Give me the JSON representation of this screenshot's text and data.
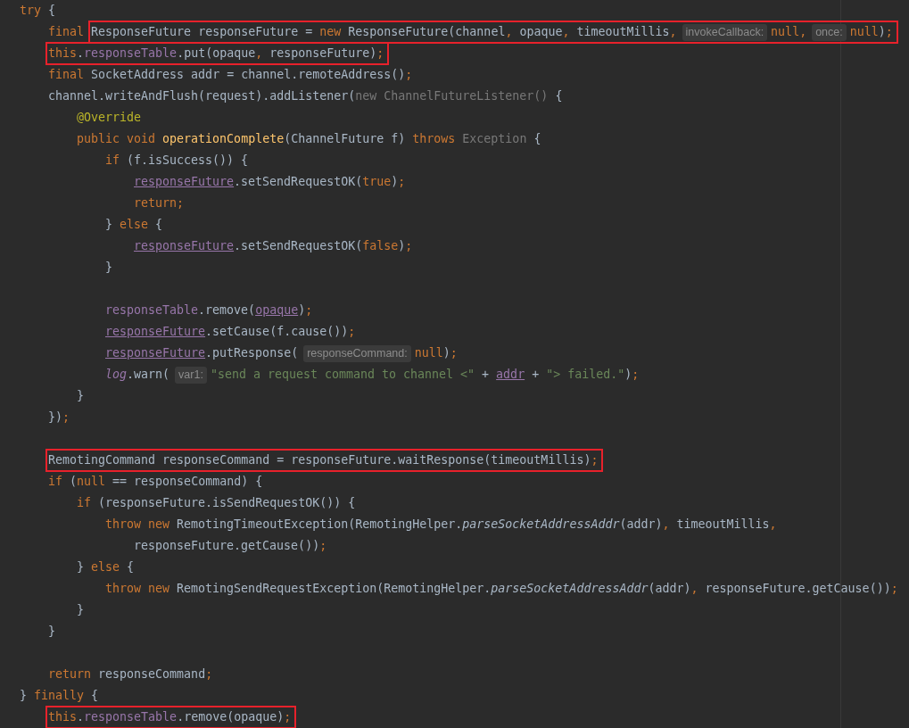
{
  "editor": {
    "lines": [
      {
        "kind": "code",
        "tokens": [
          {
            "text": "try",
            "kind": "keyword"
          },
          {
            "text": " {",
            "kind": "plain"
          }
        ],
        "children": [
          {
            "kind": "code",
            "tokens": [
              {
                "text": "final ",
                "kind": "keyword"
              }
            ],
            "marked": [
              {
                "text": "ResponseFuture responseFuture = ",
                "kind": "plain"
              },
              {
                "text": "new",
                "kind": "keyword"
              },
              {
                "text": " ResponseFuture(channel",
                "kind": "plain"
              },
              {
                "text": ",",
                "kind": "punct"
              },
              {
                "text": " opaque",
                "kind": "plain"
              },
              {
                "text": ",",
                "kind": "punct"
              },
              {
                "text": " timeoutMillis",
                "kind": "plain"
              },
              {
                "text": ",",
                "kind": "punct"
              },
              {
                "text": "invokeCallback:",
                "kind": "hint"
              },
              {
                "text": "null",
                "kind": "keyword"
              },
              {
                "text": ",",
                "kind": "punct"
              },
              {
                "text": "once:",
                "kind": "hint"
              },
              {
                "text": "null",
                "kind": "keyword"
              },
              {
                "text": ")",
                "kind": "plain"
              },
              {
                "text": ";",
                "kind": "punct"
              }
            ]
          },
          {
            "kind": "code",
            "marked": [
              {
                "text": "this",
                "kind": "keyword"
              },
              {
                "text": ".",
                "kind": "plain"
              },
              {
                "text": "responseTable",
                "kind": "field"
              },
              {
                "text": ".put(opaque",
                "kind": "plain"
              },
              {
                "text": ",",
                "kind": "punct"
              },
              {
                "text": " responseFuture)",
                "kind": "plain"
              },
              {
                "text": ";",
                "kind": "punct"
              }
            ]
          },
          {
            "kind": "code",
            "tokens": [
              {
                "text": "final",
                "kind": "keyword"
              },
              {
                "text": " SocketAddress addr = channel.remoteAddress()",
                "kind": "plain"
              },
              {
                "text": ";",
                "kind": "punct"
              }
            ]
          },
          {
            "kind": "code",
            "tokens": [
              {
                "text": "channel.writeAndFlush(request).addListener(",
                "kind": "plain"
              },
              {
                "text": "new ChannelFutureListener()",
                "kind": "muted"
              },
              {
                "text": " {",
                "kind": "plain"
              }
            ],
            "children": [
              {
                "kind": "code",
                "tokens": [
                  {
                    "text": "@Override",
                    "kind": "annotation"
                  }
                ]
              },
              {
                "kind": "code",
                "tokens": [
                  {
                    "text": "public void",
                    "kind": "keyword"
                  },
                  {
                    "text": " operationComplete",
                    "kind": "method-decl"
                  },
                  {
                    "text": "(ChannelFuture f) ",
                    "kind": "plain"
                  },
                  {
                    "text": "throws",
                    "kind": "keyword"
                  },
                  {
                    "text": " Exception",
                    "kind": "muted"
                  },
                  {
                    "text": " {",
                    "kind": "plain"
                  }
                ],
                "children": [
                  {
                    "kind": "code",
                    "tokens": [
                      {
                        "text": "if",
                        "kind": "keyword"
                      },
                      {
                        "text": " (f.isSuccess()) {",
                        "kind": "plain"
                      }
                    ],
                    "children": [
                      {
                        "kind": "code",
                        "tokens": [
                          {
                            "text": "responseFuture",
                            "kind": "captured"
                          },
                          {
                            "text": ".setSendRequestOK(",
                            "kind": "plain"
                          },
                          {
                            "text": "true",
                            "kind": "keyword"
                          },
                          {
                            "text": ")",
                            "kind": "plain"
                          },
                          {
                            "text": ";",
                            "kind": "punct"
                          }
                        ]
                      },
                      {
                        "kind": "code",
                        "tokens": [
                          {
                            "text": "return;",
                            "kind": "keyword"
                          }
                        ]
                      }
                    ]
                  },
                  {
                    "kind": "code",
                    "tokens": [
                      {
                        "text": "}",
                        "kind": "plain"
                      },
                      {
                        "text": " else",
                        "kind": "keyword"
                      },
                      {
                        "text": " {",
                        "kind": "plain"
                      }
                    ],
                    "children": [
                      {
                        "kind": "code",
                        "tokens": [
                          {
                            "text": "responseFuture",
                            "kind": "captured"
                          },
                          {
                            "text": ".setSendRequestOK(",
                            "kind": "plain"
                          },
                          {
                            "text": "false",
                            "kind": "keyword"
                          },
                          {
                            "text": ")",
                            "kind": "plain"
                          },
                          {
                            "text": ";",
                            "kind": "punct"
                          }
                        ]
                      }
                    ]
                  },
                  {
                    "kind": "code",
                    "tokens": [
                      {
                        "text": "}",
                        "kind": "plain"
                      }
                    ]
                  },
                  {
                    "kind": "blank"
                  },
                  {
                    "kind": "code",
                    "tokens": [
                      {
                        "text": "responseTable",
                        "kind": "field"
                      },
                      {
                        "text": ".remove(",
                        "kind": "plain"
                      },
                      {
                        "text": "opaque",
                        "kind": "captured"
                      },
                      {
                        "text": ")",
                        "kind": "plain"
                      },
                      {
                        "text": ";",
                        "kind": "punct"
                      }
                    ]
                  },
                  {
                    "kind": "code",
                    "tokens": [
                      {
                        "text": "responseFuture",
                        "kind": "captured"
                      },
                      {
                        "text": ".setCause(f.cause())",
                        "kind": "plain"
                      },
                      {
                        "text": ";",
                        "kind": "punct"
                      }
                    ]
                  },
                  {
                    "kind": "code",
                    "tokens": [
                      {
                        "text": "responseFuture",
                        "kind": "captured"
                      },
                      {
                        "text": ".putResponse(",
                        "kind": "plain"
                      },
                      {
                        "text": "responseCommand:",
                        "kind": "hint"
                      },
                      {
                        "text": "null",
                        "kind": "keyword"
                      },
                      {
                        "text": ")",
                        "kind": "plain"
                      },
                      {
                        "text": ";",
                        "kind": "punct"
                      }
                    ]
                  },
                  {
                    "kind": "code",
                    "tokens": [
                      {
                        "text": "log",
                        "kind": "static-field"
                      },
                      {
                        "text": ".warn(",
                        "kind": "plain"
                      },
                      {
                        "text": "var1:",
                        "kind": "hint"
                      },
                      {
                        "text": "\"send a request command to channel <\"",
                        "kind": "string"
                      },
                      {
                        "text": " + ",
                        "kind": "plain"
                      },
                      {
                        "text": "addr",
                        "kind": "captured"
                      },
                      {
                        "text": " + ",
                        "kind": "plain"
                      },
                      {
                        "text": "\"> failed.\"",
                        "kind": "string"
                      },
                      {
                        "text": ")",
                        "kind": "plain"
                      },
                      {
                        "text": ";",
                        "kind": "punct"
                      }
                    ]
                  }
                ]
              },
              {
                "kind": "code",
                "tokens": [
                  {
                    "text": "}",
                    "kind": "plain"
                  }
                ]
              }
            ]
          },
          {
            "kind": "code",
            "tokens": [
              {
                "text": "})",
                "kind": "plain"
              },
              {
                "text": ";",
                "kind": "punct"
              }
            ]
          },
          {
            "kind": "blank"
          },
          {
            "kind": "code",
            "marked": [
              {
                "text": "RemotingCommand responseCommand = responseFuture.waitResponse(timeoutMillis)",
                "kind": "plain"
              },
              {
                "text": ";",
                "kind": "punct"
              }
            ]
          },
          {
            "kind": "code",
            "tokens": [
              {
                "text": "if",
                "kind": "keyword"
              },
              {
                "text": " (",
                "kind": "plain"
              },
              {
                "text": "null",
                "kind": "keyword"
              },
              {
                "text": " == responseCommand) {",
                "kind": "plain"
              }
            ],
            "children": [
              {
                "kind": "code",
                "tokens": [
                  {
                    "text": "if",
                    "kind": "keyword"
                  },
                  {
                    "text": " (responseFuture.isSendRequestOK()) {",
                    "kind": "plain"
                  }
                ],
                "children": [
                  {
                    "kind": "code",
                    "tokens": [
                      {
                        "text": "throw new",
                        "kind": "keyword"
                      },
                      {
                        "text": " RemotingTimeoutException(RemotingHelper.",
                        "kind": "plain"
                      },
                      {
                        "text": "parseSocketAddressAddr",
                        "kind": "static-method"
                      },
                      {
                        "text": "(addr)",
                        "kind": "plain"
                      },
                      {
                        "text": ",",
                        "kind": "punct"
                      },
                      {
                        "text": " timeoutMillis",
                        "kind": "plain"
                      },
                      {
                        "text": ",",
                        "kind": "punct"
                      }
                    ],
                    "children": [
                      {
                        "kind": "code",
                        "tokens": [
                          {
                            "text": "responseFuture.getCause())",
                            "kind": "plain"
                          },
                          {
                            "text": ";",
                            "kind": "punct"
                          }
                        ]
                      }
                    ]
                  }
                ]
              },
              {
                "kind": "code",
                "tokens": [
                  {
                    "text": "}",
                    "kind": "plain"
                  },
                  {
                    "text": " else",
                    "kind": "keyword"
                  },
                  {
                    "text": " {",
                    "kind": "plain"
                  }
                ],
                "children": [
                  {
                    "kind": "code",
                    "tokens": [
                      {
                        "text": "throw new",
                        "kind": "keyword"
                      },
                      {
                        "text": " RemotingSendRequestException(RemotingHelper.",
                        "kind": "plain"
                      },
                      {
                        "text": "parseSocketAddressAddr",
                        "kind": "static-method"
                      },
                      {
                        "text": "(addr)",
                        "kind": "plain"
                      },
                      {
                        "text": ",",
                        "kind": "punct"
                      },
                      {
                        "text": " responseFuture.getCause())",
                        "kind": "plain"
                      },
                      {
                        "text": ";",
                        "kind": "punct"
                      }
                    ]
                  }
                ]
              },
              {
                "kind": "code",
                "tokens": [
                  {
                    "text": "}",
                    "kind": "plain"
                  }
                ]
              }
            ]
          },
          {
            "kind": "code",
            "tokens": [
              {
                "text": "}",
                "kind": "plain"
              }
            ]
          },
          {
            "kind": "blank"
          },
          {
            "kind": "code",
            "tokens": [
              {
                "text": "return",
                "kind": "keyword"
              },
              {
                "text": " responseCommand",
                "kind": "plain"
              },
              {
                "text": ";",
                "kind": "punct"
              }
            ]
          }
        ]
      },
      {
        "kind": "code",
        "tokens": [
          {
            "text": "}",
            "kind": "plain"
          },
          {
            "text": " finally",
            "kind": "keyword"
          },
          {
            "text": " {",
            "kind": "plain"
          }
        ],
        "children": [
          {
            "kind": "code",
            "marked": [
              {
                "text": "this",
                "kind": "keyword"
              },
              {
                "text": ".",
                "kind": "plain"
              },
              {
                "text": "responseTable",
                "kind": "field"
              },
              {
                "text": ".remove(opaque)",
                "kind": "plain"
              },
              {
                "text": ";",
                "kind": "punct"
              }
            ]
          }
        ]
      }
    ]
  }
}
